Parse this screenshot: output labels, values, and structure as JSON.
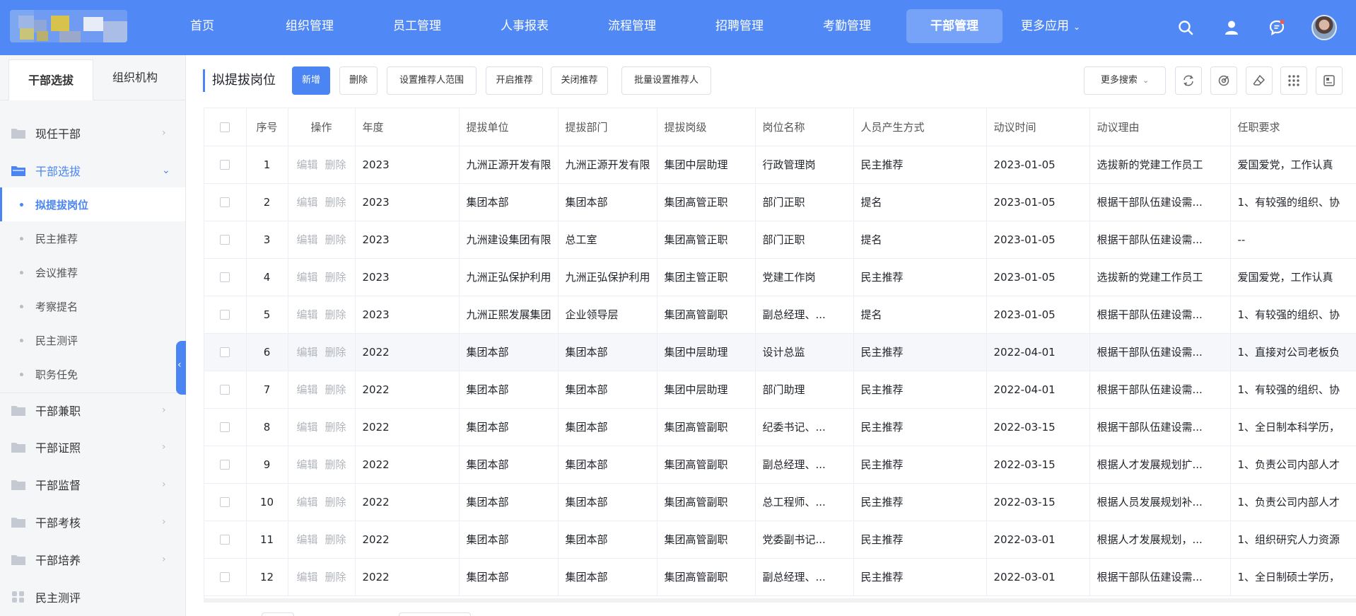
{
  "nav": {
    "items": [
      "首页",
      "组织管理",
      "员工管理",
      "人事报表",
      "流程管理",
      "招聘管理",
      "考勤管理",
      "干部管理",
      "更多应用"
    ],
    "active_index": 7
  },
  "sidebar": {
    "tabs": [
      "干部选拔",
      "组织机构"
    ],
    "active_tab": 0,
    "menu": [
      {
        "label": "现任干部"
      },
      {
        "label": "干部选拔"
      },
      {
        "label": "拟提拔岗位"
      },
      {
        "label": "民主推荐"
      },
      {
        "label": "会议推荐"
      },
      {
        "label": "考察提名"
      },
      {
        "label": "民主测评"
      },
      {
        "label": "职务任免"
      },
      {
        "label": "干部兼职"
      },
      {
        "label": "干部证照"
      },
      {
        "label": "干部监督"
      },
      {
        "label": "干部考核"
      },
      {
        "label": "干部培养"
      },
      {
        "label": "民主测评"
      }
    ]
  },
  "toolbar": {
    "title": "拟提拔岗位",
    "buttons": [
      "新增",
      "删除",
      "设置推荐人范围",
      "开启推荐",
      "关闭推荐",
      "批量设置推荐人"
    ],
    "more_search": "更多搜索"
  },
  "table": {
    "headers": [
      "序号",
      "操作",
      "年度",
      "提拔单位",
      "提拔部门",
      "提拔岗级",
      "岗位名称",
      "人员产生方式",
      "动议时间",
      "动议理由",
      "任职要求"
    ],
    "op_edit": "编辑",
    "op_delete": "删除",
    "rows": [
      [
        "1",
        "2023",
        "九洲正源开发有限",
        "九洲正源开发有限",
        "集团中层助理",
        "行政管理岗",
        "民主推荐",
        "2023-01-05",
        "选拔新的党建工作员工",
        "爱国爱党，工作认真"
      ],
      [
        "2",
        "2023",
        "集团本部",
        "集团本部",
        "集团高管正职",
        "部门正职",
        "提名",
        "2023-01-05",
        "根据干部队伍建设需...",
        "1、有较强的组织、协"
      ],
      [
        "3",
        "2023",
        "九洲建设集团有限",
        "总工室",
        "集团高管正职",
        "部门正职",
        "提名",
        "2023-01-05",
        "根据干部队伍建设需...",
        "--"
      ],
      [
        "4",
        "2023",
        "九洲正弘保护利用",
        "九洲正弘保护利用",
        "集团主管正职",
        "党建工作岗",
        "民主推荐",
        "2023-01-05",
        "选拔新的党建工作员工",
        "爱国爱党，工作认真"
      ],
      [
        "5",
        "2023",
        "九洲正熙发展集团",
        "企业领导层",
        "集团高管副职",
        "副总经理、...",
        "提名",
        "2023-01-05",
        "根据干部队伍建设需...",
        "1、有较强的组织、协"
      ],
      [
        "6",
        "2022",
        "集团本部",
        "集团本部",
        "集团中层助理",
        "设计总监",
        "民主推荐",
        "2022-04-01",
        "根据干部队伍建设需...",
        "1、直接对公司老板负"
      ],
      [
        "7",
        "2022",
        "集团本部",
        "集团本部",
        "集团中层助理",
        "部门助理",
        "民主推荐",
        "2022-04-01",
        "根据干部队伍建设需...",
        "1、有较强的组织、协"
      ],
      [
        "8",
        "2022",
        "集团本部",
        "集团本部",
        "集团高管副职",
        "纪委书记、...",
        "民主推荐",
        "2022-03-15",
        "根据干部队伍建设需...",
        "1、全日制本科学历，"
      ],
      [
        "9",
        "2022",
        "集团本部",
        "集团本部",
        "集团高管副职",
        "副总经理、...",
        "民主推荐",
        "2022-03-15",
        "根据人才发展规划扩...",
        "1、负责公司内部人才"
      ],
      [
        "10",
        "2022",
        "集团本部",
        "集团本部",
        "集团高管副职",
        "总工程师、...",
        "民主推荐",
        "2022-03-15",
        "根据人员发展规划补...",
        "1、负责公司内部人才"
      ],
      [
        "11",
        "2022",
        "集团本部",
        "集团本部",
        "集团高管副职",
        "党委副书记...",
        "民主推荐",
        "2022-03-01",
        "根据人才发展规划，...",
        "1、组织研究人力资源"
      ],
      [
        "12",
        "2022",
        "集团本部",
        "集团本部",
        "集团高管副职",
        "副总经理、...",
        "民主推荐",
        "2022-03-01",
        "根据干部队伍建设需...",
        "1、全日制硕士学历，"
      ]
    ]
  },
  "colors": {
    "brand": "#5089f5",
    "accent": "#4a85f3"
  }
}
